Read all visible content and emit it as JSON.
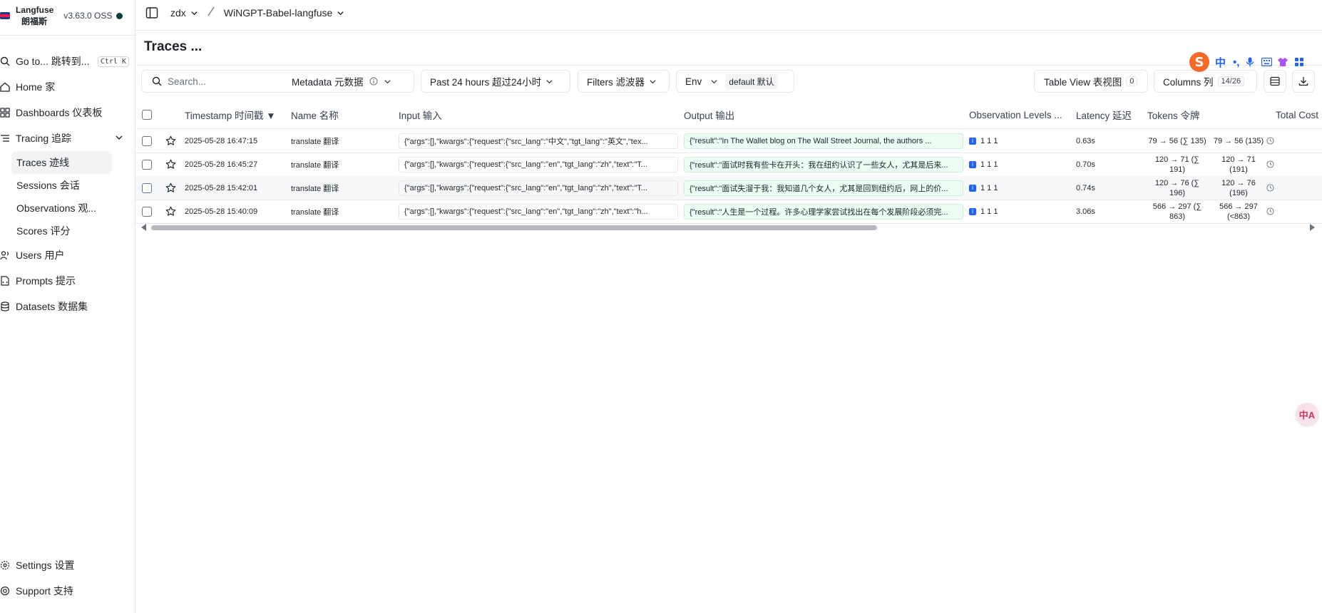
{
  "brand": {
    "name_line1": "Langfuse",
    "name_line2": "朗福斯",
    "version": "v3.63.0 OSS"
  },
  "sidebar": {
    "items": [
      {
        "label": "Go to...   跳转到...",
        "shortcut": "Ctrl K"
      },
      {
        "label": "Home  家"
      },
      {
        "label": "Dashboards  仪表板"
      },
      {
        "label": "Tracing  追踪"
      }
    ],
    "tracing_sub": [
      {
        "label": "Traces  迹线"
      },
      {
        "label": "Sessions  会话"
      },
      {
        "label": "Observations  观..."
      },
      {
        "label": "Scores  评分"
      }
    ],
    "items_after": [
      {
        "label": "Users  用户"
      },
      {
        "label": "Prompts  提示"
      },
      {
        "label": "Datasets  数据集"
      }
    ],
    "bottom": [
      {
        "label": "Settings  设置"
      },
      {
        "label": "Support    支持"
      }
    ]
  },
  "topbar": {
    "org": "zdx",
    "project": "WiNGPT-Babel-langfuse"
  },
  "page": {
    "title": "Traces ..."
  },
  "toolbar": {
    "search_placeholder": "Search...",
    "metadata_label": "Metadata   元数据",
    "time_range": "Past 24 hours   超过24小时",
    "filters_label": "Filters  滤波器",
    "env_label": "Env",
    "env_value": "default 默认",
    "table_view_label": "Table View  表视图",
    "table_view_count": "0",
    "columns_label": "Columns  列",
    "columns_count": "14/26"
  },
  "table": {
    "headers": {
      "timestamp": "Timestamp  时间戳 ▼",
      "name": "Name  名称",
      "input": "Input  输入",
      "output": "Output  输出",
      "levels": "Observation Levels  ...",
      "latency": "Latency  延迟",
      "tokens": "Tokens  令牌",
      "cost": "Total Cost"
    },
    "rows": [
      {
        "timestamp": "2025-05-28 16:47:15",
        "name": "translate  翻译",
        "input": "{\"args\":[],\"kwargs\":{\"request\":{\"src_lang\":\"中文\",\"tgt_lang\":\"英文\",\"tex...",
        "output": "{\"result\":\"In The Wallet blog on The Wall Street Journal, the authors ...",
        "levels": "1  1  1",
        "latency": "0.63s",
        "tokens_a": "79 → 56 (∑ 135)",
        "tokens_b": "79 → 56 (135)"
      },
      {
        "timestamp": "2025-05-28 16:45:27",
        "name": "translate  翻译",
        "input": "{\"args\":[],\"kwargs\":{\"request\":{\"src_lang\":\"en\",\"tgt_lang\":\"zh\",\"text\":\"T...",
        "output": "{\"result\":\"面试时我有些卡在开头：我在纽约认识了一些女人，尤其是后来...",
        "levels": "1  1  1",
        "latency": "0.70s",
        "tokens_a": "120 → 71 (∑ 191)",
        "tokens_b": "120 → 71 (191)"
      },
      {
        "timestamp": "2025-05-28 15:42:01",
        "name": "translate  翻译",
        "input": "{\"args\":[],\"kwargs\":{\"request\":{\"src_lang\":\"en\",\"tgt_lang\":\"zh\",\"text\":\"T...",
        "output": "{\"result\":\"面试失溜于我：我知道几个女人，尤其是回到纽约后，网上的价...",
        "levels": "1  1  1",
        "latency": "0.74s",
        "tokens_a": "120 → 76 (∑ 196)",
        "tokens_b": "120 → 76 (196)"
      },
      {
        "timestamp": "2025-05-28 15:40:09",
        "name": "translate  翻译",
        "input": "{\"args\":[],\"kwargs\":{\"request\":{\"src_lang\":\"en\",\"tgt_lang\":\"zh\",\"text\":\"h...",
        "output": "{\"result\":\"人生是一个过程。许多心理学家尝试找出在每个发展阶段必须完...",
        "levels": "1  1  1",
        "latency": "3.06s",
        "tokens_a": "566 → 297 (∑ 863)",
        "tokens_b": "566 → 297 (<863)"
      }
    ]
  },
  "ime": {
    "logo": "S",
    "mode": "中",
    "punct": "•,"
  },
  "float_button": {
    "label": "中A"
  },
  "colors": {
    "accent": "#2563eb",
    "output_bg": "#ecfdf3",
    "status_dot": "#0f3b3a",
    "ime_orange": "#f46a2a"
  }
}
